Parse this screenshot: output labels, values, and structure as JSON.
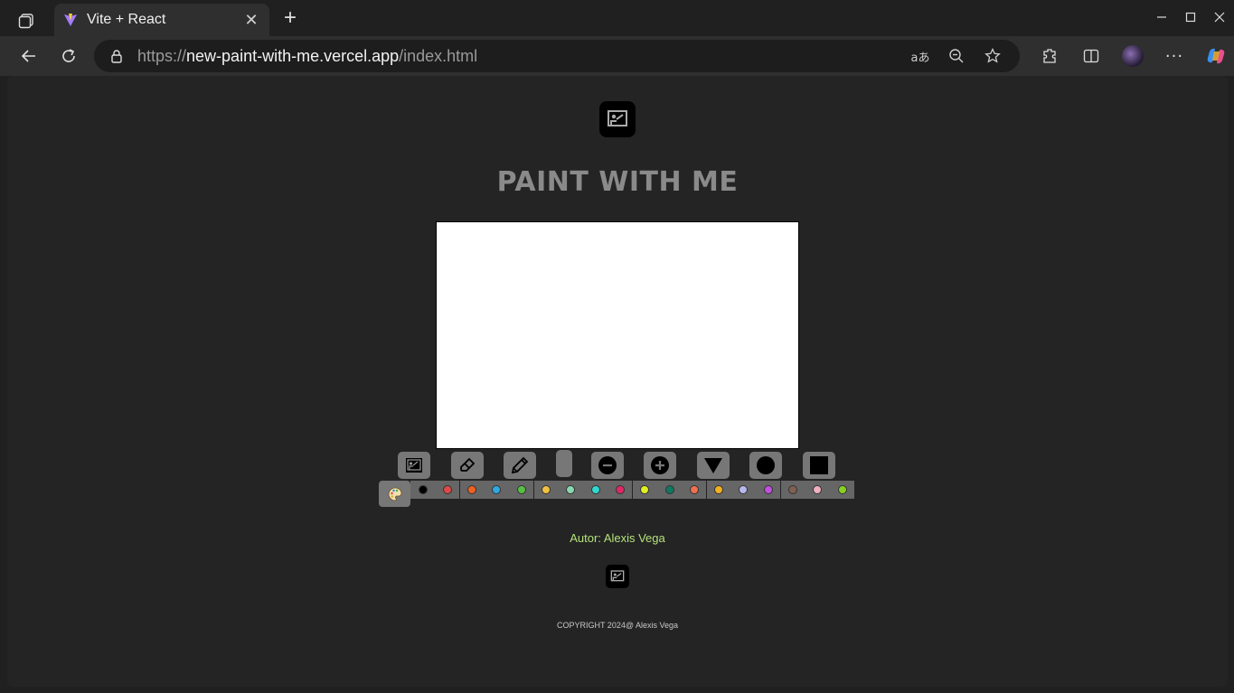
{
  "browser": {
    "tab_title": "Vite + React",
    "url_prefix": "https://",
    "url_host": "new-paint-with-me.vercel.app",
    "url_path": "/index.html"
  },
  "page": {
    "title": "PAINT WITH ME",
    "author": "Autor: Alexis Vega",
    "copyright": "COPYRIGHT 2024@ Alexis Vega"
  },
  "tools": [
    {
      "name": "logo-tool",
      "icon": "easel-icon"
    },
    {
      "name": "eraser",
      "icon": "eraser-icon"
    },
    {
      "name": "pencil",
      "icon": "pencil-icon"
    },
    {
      "name": "brush-size",
      "icon": "size-indicator"
    },
    {
      "name": "decrease-size",
      "icon": "minus-circle-icon"
    },
    {
      "name": "increase-size",
      "icon": "plus-circle-icon"
    },
    {
      "name": "triangle",
      "icon": "triangle-icon"
    },
    {
      "name": "circle",
      "icon": "circle-icon"
    },
    {
      "name": "square",
      "icon": "square-icon"
    }
  ],
  "palette": {
    "icon": "palette-icon",
    "colors": [
      "#000000",
      "#e04848",
      "#f06020",
      "#30a8e0",
      "#58c040",
      "#f0c040",
      "#88d8b0",
      "#30d8d0",
      "#e02868",
      "#e0f020",
      "#107860",
      "#f07050",
      "#f0b020",
      "#b8b8f0",
      "#c050e0",
      "#806050",
      "#f0b0c0",
      "#88d020"
    ]
  }
}
